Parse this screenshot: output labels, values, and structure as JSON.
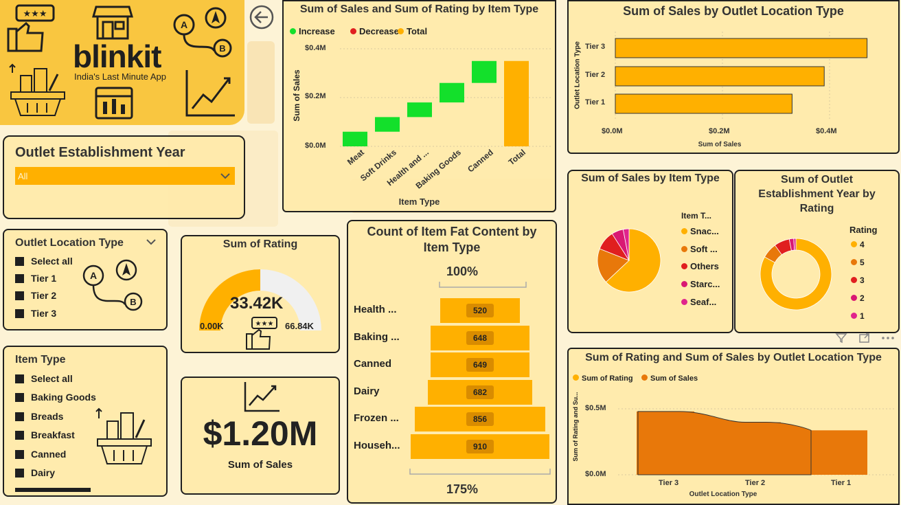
{
  "brand": {
    "name": "blinkit",
    "tagline": "India's Last Minute App"
  },
  "colors": {
    "accent": "#ffb000",
    "dark_orange": "#e8780a",
    "green": "#13e02b",
    "red": "#e01f1f",
    "pink": "#d91873",
    "magenta": "#e0248c",
    "brand_green": "#1e8a2e",
    "logo_yellow": "#f9c640"
  },
  "year_slicer": {
    "title": "Outlet Establishment Year",
    "value": "All"
  },
  "location_slicer": {
    "title": "Outlet Location Type",
    "items": [
      "Select all",
      "Tier 1",
      "Tier 2",
      "Tier 3"
    ]
  },
  "item_slicer": {
    "title": "Item Type",
    "items": [
      "Select all",
      "Baking Goods",
      "Breads",
      "Breakfast",
      "Canned",
      "Dairy"
    ]
  },
  "rating_gauge": {
    "title": "Sum of Rating",
    "value": "33.42K",
    "min": "0.00K",
    "max": "66.84K",
    "fraction": 0.5
  },
  "sales_card": {
    "value": "$1.20M",
    "label": "Sum of Sales"
  },
  "waterfall": {
    "title": "Sum of Sales and Sum of Rating by Item Type",
    "legend": [
      "Increase",
      "Decrease",
      "Total"
    ],
    "ylabel": "Sum of Sales",
    "xlabel": "Item Type",
    "yticks": [
      "$0.4M",
      "$0.2M",
      "$0.0M"
    ],
    "categories": [
      "Meat",
      "Soft Drinks",
      "Health and ...",
      "Baking Goods",
      "Canned",
      "Total"
    ]
  },
  "funnel": {
    "title": "Count of Item Fat Content by Item Type",
    "top_pct": "100%",
    "bottom_pct": "175%",
    "rows": [
      {
        "label": "Health ...",
        "value": "520"
      },
      {
        "label": "Baking ...",
        "value": "648"
      },
      {
        "label": "Canned",
        "value": "649"
      },
      {
        "label": "Dairy",
        "value": "682"
      },
      {
        "label": "Frozen ...",
        "value": "856"
      },
      {
        "label": "Househ...",
        "value": "910"
      }
    ]
  },
  "location_bar": {
    "title": "Sum of Sales by Outlet Location Type",
    "ylabel": "Outlet Location Type",
    "xlabel": "Sum of Sales",
    "xticks": [
      "$0.0M",
      "$0.2M",
      "$0.4M"
    ],
    "categories": [
      "Tier 3",
      "Tier 2",
      "Tier 1"
    ]
  },
  "pie": {
    "title": "Sum of Sales by Item Type",
    "legend_title": "Item T...",
    "legend": [
      "Snac...",
      "Soft ...",
      "Others",
      "Starc...",
      "Seaf..."
    ]
  },
  "donut": {
    "title": "Sum of Outlet Establishment Year by Rating",
    "legend_title": "Rating",
    "legend": [
      "4",
      "5",
      "3",
      "2",
      "1"
    ]
  },
  "combo": {
    "title": "Sum of Rating and Sum of Sales by Outlet Location Type",
    "legend": [
      "Sum of Rating",
      "Sum of Sales"
    ],
    "ylabel": "Sum of Rating and Su...",
    "xlabel": "Outlet Location Type",
    "yticks": [
      "$0.5M",
      "$0.0M"
    ],
    "categories": [
      "Tier 3",
      "Tier 2",
      "Tier 1"
    ]
  },
  "chart_data": [
    {
      "type": "bar",
      "subtype": "waterfall",
      "title": "Sum of Sales and Sum of Rating by Item Type",
      "categories": [
        "Meat",
        "Soft Drinks",
        "Health and ...",
        "Baking Goods",
        "Canned",
        "Total"
      ],
      "values": [
        0.06,
        0.06,
        0.06,
        0.08,
        0.09,
        0.35
      ],
      "ylim": [
        0,
        0.4
      ],
      "xlabel": "Item Type",
      "ylabel": "Sum of Sales"
    },
    {
      "type": "bar",
      "subtype": "funnel",
      "title": "Count of Item Fat Content by Item Type",
      "categories": [
        "Health ...",
        "Baking ...",
        "Canned",
        "Dairy",
        "Frozen ...",
        "Househ..."
      ],
      "values": [
        520,
        648,
        649,
        682,
        856,
        910
      ]
    },
    {
      "type": "bar",
      "orientation": "horizontal",
      "title": "Sum of Sales by Outlet Location Type",
      "categories": [
        "Tier 3",
        "Tier 2",
        "Tier 1"
      ],
      "values": [
        0.47,
        0.39,
        0.33
      ],
      "xlim": [
        0,
        0.5
      ],
      "xlabel": "Sum of Sales",
      "ylabel": "Outlet Location Type"
    },
    {
      "type": "pie",
      "title": "Sum of Sales by Item Type",
      "categories": [
        "Snac...",
        "Soft ...",
        "Others",
        "Starc...",
        "Seaf..."
      ],
      "values": [
        63,
        18,
        10,
        6,
        3
      ]
    },
    {
      "type": "pie",
      "subtype": "donut",
      "title": "Sum of Outlet Establishment Year by Rating",
      "categories": [
        "4",
        "5",
        "3",
        "2",
        "1"
      ],
      "values": [
        83,
        7,
        7,
        2,
        1
      ]
    },
    {
      "type": "bar",
      "subtype": "combo",
      "title": "Sum of Rating and Sum of Sales by Outlet Location Type",
      "categories": [
        "Tier 3",
        "Tier 2",
        "Tier 1"
      ],
      "series": [
        {
          "name": "Sum of Sales",
          "values": [
            0.47,
            0.39,
            0.33
          ]
        },
        {
          "name": "Sum of Rating",
          "values": [
            0.0129,
            0.0107,
            0.0091
          ]
        }
      ],
      "ylim": [
        0,
        0.5
      ],
      "xlabel": "Outlet Location Type",
      "ylabel": "Sum of Rating and Su..."
    }
  ]
}
